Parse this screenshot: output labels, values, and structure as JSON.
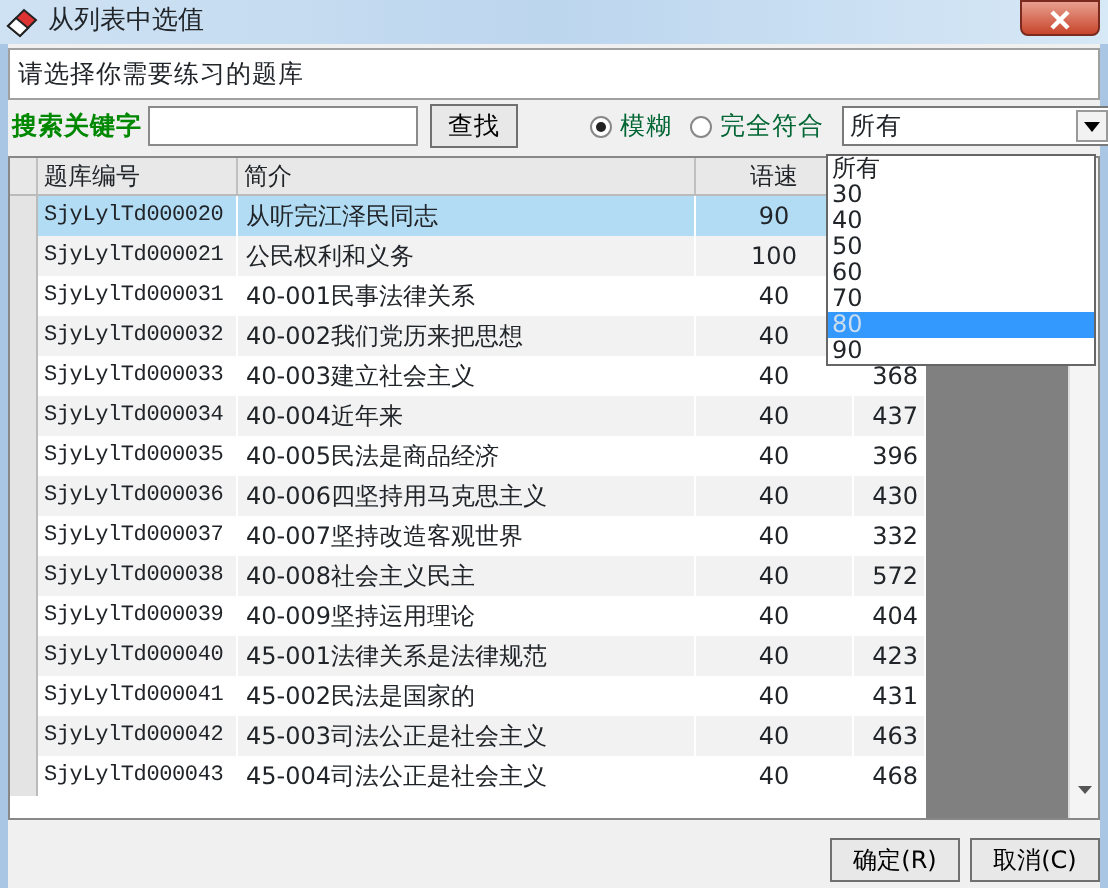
{
  "window": {
    "title": "从列表中选值"
  },
  "prompt": "请选择你需要练习的题库",
  "search": {
    "label": "搜索关键字",
    "button": "查找"
  },
  "match_modes": [
    {
      "label": "模糊",
      "selected": true
    },
    {
      "label": "完全符合",
      "selected": false
    }
  ],
  "speed_filter": {
    "value": "所有",
    "expanded": true,
    "options": [
      {
        "label": "所有",
        "highlighted": false
      },
      {
        "label": "30",
        "highlighted": false
      },
      {
        "label": "40",
        "highlighted": false
      },
      {
        "label": "50",
        "highlighted": false
      },
      {
        "label": "60",
        "highlighted": false
      },
      {
        "label": "70",
        "highlighted": false
      },
      {
        "label": "80",
        "highlighted": true
      },
      {
        "label": "90",
        "highlighted": false
      }
    ]
  },
  "table": {
    "columns": [
      "题库编号",
      "简介",
      "语速"
    ],
    "rows": [
      {
        "id": "SjyLylTd000020",
        "intro": "从听完江泽民同志",
        "speed": "90",
        "selected": true
      },
      {
        "id": "SjyLylTd000021",
        "intro": "公民权利和义务",
        "speed": "100",
        "selected": false
      },
      {
        "id": "SjyLylTd000031",
        "intro": "40-001民事法律关系",
        "speed": "40",
        "selected": false
      },
      {
        "id": "SjyLylTd000032",
        "intro": "40-002我们党历来把思想",
        "speed": "40",
        "selected": false
      },
      {
        "id": "SjyLylTd000033",
        "intro": "40-003建立社会主义",
        "speed": "40",
        "count": "368",
        "selected": false
      },
      {
        "id": "SjyLylTd000034",
        "intro": "40-004近年来",
        "speed": "40",
        "count": "437",
        "selected": false
      },
      {
        "id": "SjyLylTd000035",
        "intro": "40-005民法是商品经济",
        "speed": "40",
        "count": "396",
        "selected": false
      },
      {
        "id": "SjyLylTd000036",
        "intro": "40-006四坚持用马克思主义",
        "speed": "40",
        "count": "430",
        "selected": false
      },
      {
        "id": "SjyLylTd000037",
        "intro": "40-007坚持改造客观世界",
        "speed": "40",
        "count": "332",
        "selected": false
      },
      {
        "id": "SjyLylTd000038",
        "intro": "40-008社会主义民主",
        "speed": "40",
        "count": "572",
        "selected": false
      },
      {
        "id": "SjyLylTd000039",
        "intro": "40-009坚持运用理论",
        "speed": "40",
        "count": "404",
        "selected": false
      },
      {
        "id": "SjyLylTd000040",
        "intro": "45-001法律关系是法律规范",
        "speed": "40",
        "count": "423",
        "selected": false
      },
      {
        "id": "SjyLylTd000041",
        "intro": "45-002民法是国家的",
        "speed": "40",
        "count": "431",
        "selected": false
      },
      {
        "id": "SjyLylTd000042",
        "intro": "45-003司法公正是社会主义",
        "speed": "40",
        "count": "463",
        "selected": false
      },
      {
        "id": "SjyLylTd000043",
        "intro": "45-004司法公正是社会主义",
        "speed": "40",
        "count": "468",
        "selected": false
      }
    ]
  },
  "buttons": [
    "确定(R)",
    "取消(C)"
  ]
}
